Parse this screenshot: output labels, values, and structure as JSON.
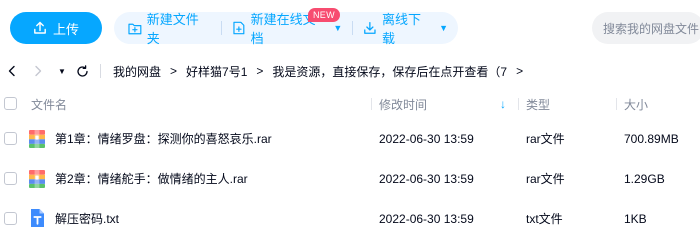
{
  "toolbar": {
    "upload_label": "上传",
    "new_folder_label": "新建文件夹",
    "new_online_doc_label": "新建在线文档",
    "new_badge": "NEW",
    "offline_download_label": "离线下载",
    "search_placeholder": "搜索我的网盘文件"
  },
  "breadcrumb": {
    "items": [
      "我的网盘",
      "好样猫7号1",
      "我是资源，直接保存，保存后在点开查看（7"
    ]
  },
  "table": {
    "columns": {
      "name": "文件名",
      "modified": "修改时间",
      "type": "类型",
      "size": "大小"
    },
    "sort_indicator": "↓",
    "rows": [
      {
        "name": "第1章：情绪罗盘：探测你的喜怒哀乐.rar",
        "modified": "2022-06-30 13:59",
        "type": "rar文件",
        "size": "700.89MB",
        "icon": "rar-archive-icon"
      },
      {
        "name": "第2章：情绪舵手：做情绪的主人.rar",
        "modified": "2022-06-30 13:59",
        "type": "rar文件",
        "size": "1.29GB",
        "icon": "rar-archive-icon"
      },
      {
        "name": "解压密码.txt",
        "modified": "2022-06-30 13:59",
        "type": "txt文件",
        "size": "1KB",
        "icon": "txt-file-icon"
      }
    ]
  },
  "colors": {
    "accent": "#06a7ff",
    "badge": "#f74c70",
    "muted_text": "#818999"
  }
}
